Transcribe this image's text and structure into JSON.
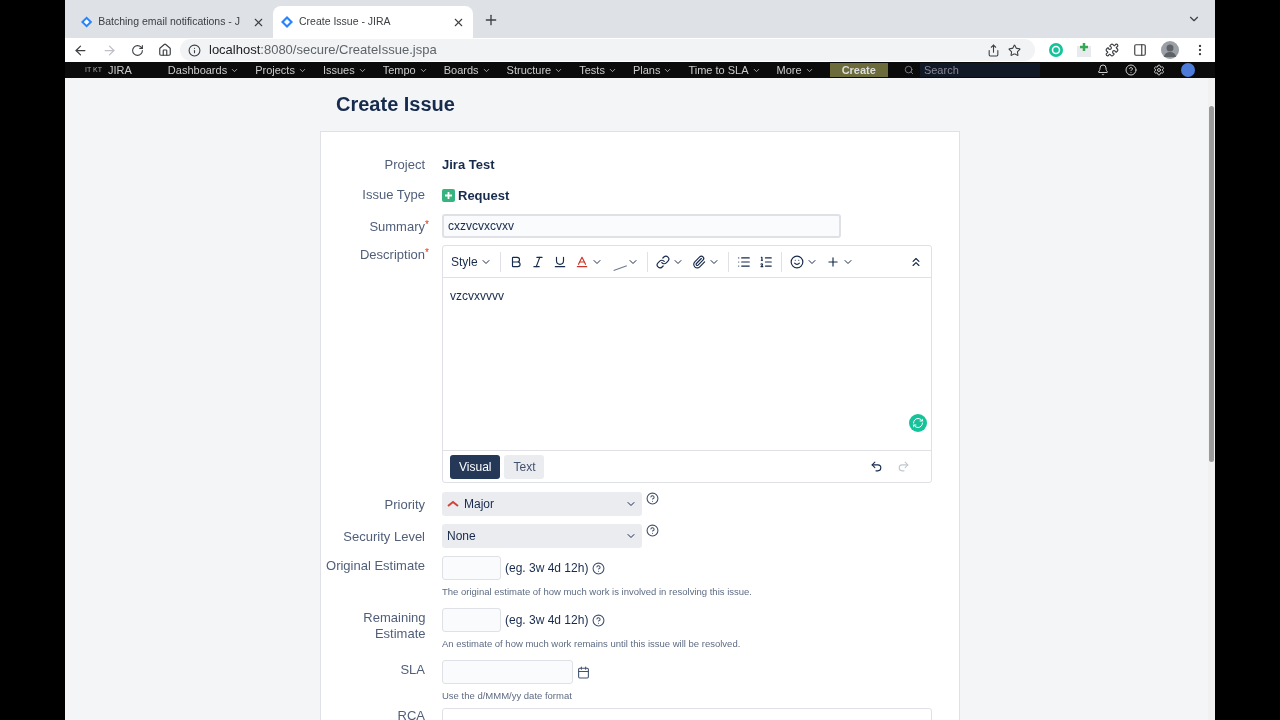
{
  "browser": {
    "tabs": [
      {
        "title": "Batching email notifications - J",
        "selected": false
      },
      {
        "title": "Create Issue - JIRA",
        "selected": true
      }
    ],
    "url": {
      "host": "localhost",
      "path": ":8080/secure/CreateIssue.jspa"
    }
  },
  "jira_nav": {
    "logo_tag": "IT KT",
    "logo": "JIRA",
    "menus": [
      "Dashboards",
      "Projects",
      "Issues",
      "Tempo",
      "Boards",
      "Structure",
      "Tests",
      "Plans",
      "Time to SLA",
      "More"
    ],
    "create_button": "Create",
    "search": {
      "placeholder": "Search"
    }
  },
  "page_title": "Create Issue",
  "form": {
    "required_mark": "*",
    "project": {
      "label": "Project",
      "value": "Jira Test"
    },
    "issue_type": {
      "label": "Issue Type",
      "value": "Request"
    },
    "summary": {
      "label": "Summary",
      "required": true,
      "value": "cxzvcvxcvxv"
    },
    "description": {
      "label": "Description",
      "required": true,
      "style_menu": "Style",
      "value": "vzcvxvvvv",
      "modes": [
        {
          "label": "Visual",
          "selected": true
        },
        {
          "label": "Text",
          "selected": false
        }
      ]
    },
    "priority": {
      "label": "Priority",
      "value": "Major"
    },
    "security_level": {
      "label": "Security Level",
      "value": "None"
    },
    "original_estimate": {
      "label": "Original Estimate",
      "hint": "(eg. 3w 4d 12h)",
      "help": "The original estimate of how much work is involved in resolving this issue."
    },
    "remaining_estimate": {
      "label": "Remaining Estimate",
      "hint": "(eg. 3w 4d 12h)",
      "help": "An estimate of how much work remains until this issue will be resolved."
    },
    "sla": {
      "label": "SLA",
      "help": "Use the d/MMM/yy date format"
    },
    "rca": {
      "label": "RCA"
    }
  }
}
